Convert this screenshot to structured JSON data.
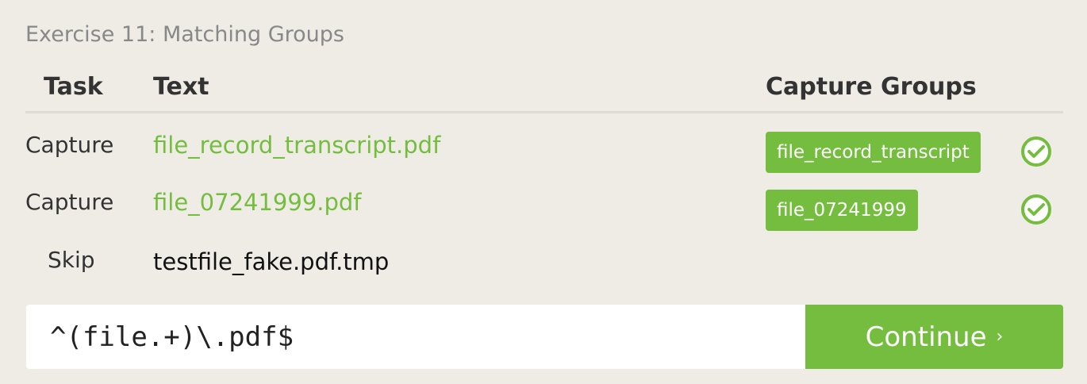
{
  "exercise": {
    "title": "Exercise 11: Matching Groups"
  },
  "table": {
    "headers": {
      "task": "Task",
      "text": "Text",
      "groups": "Capture Groups"
    },
    "rows": [
      {
        "task": "Capture",
        "text": "file_record_transcript.pdf",
        "group": "file_record_transcript",
        "status": "check-icon"
      },
      {
        "task": "Capture",
        "text": "file_07241999.pdf",
        "group": "file_07241999",
        "status": "check-icon"
      },
      {
        "task": "Skip",
        "text": "testfile_fake.pdf.tmp"
      }
    ]
  },
  "input": {
    "value": "^(file.+)\\.pdf$"
  },
  "continue_button": {
    "label": "Continue",
    "chevron": "›"
  },
  "colors": {
    "accent": "#74bd3e",
    "background": "#efece6",
    "title": "#888888"
  }
}
